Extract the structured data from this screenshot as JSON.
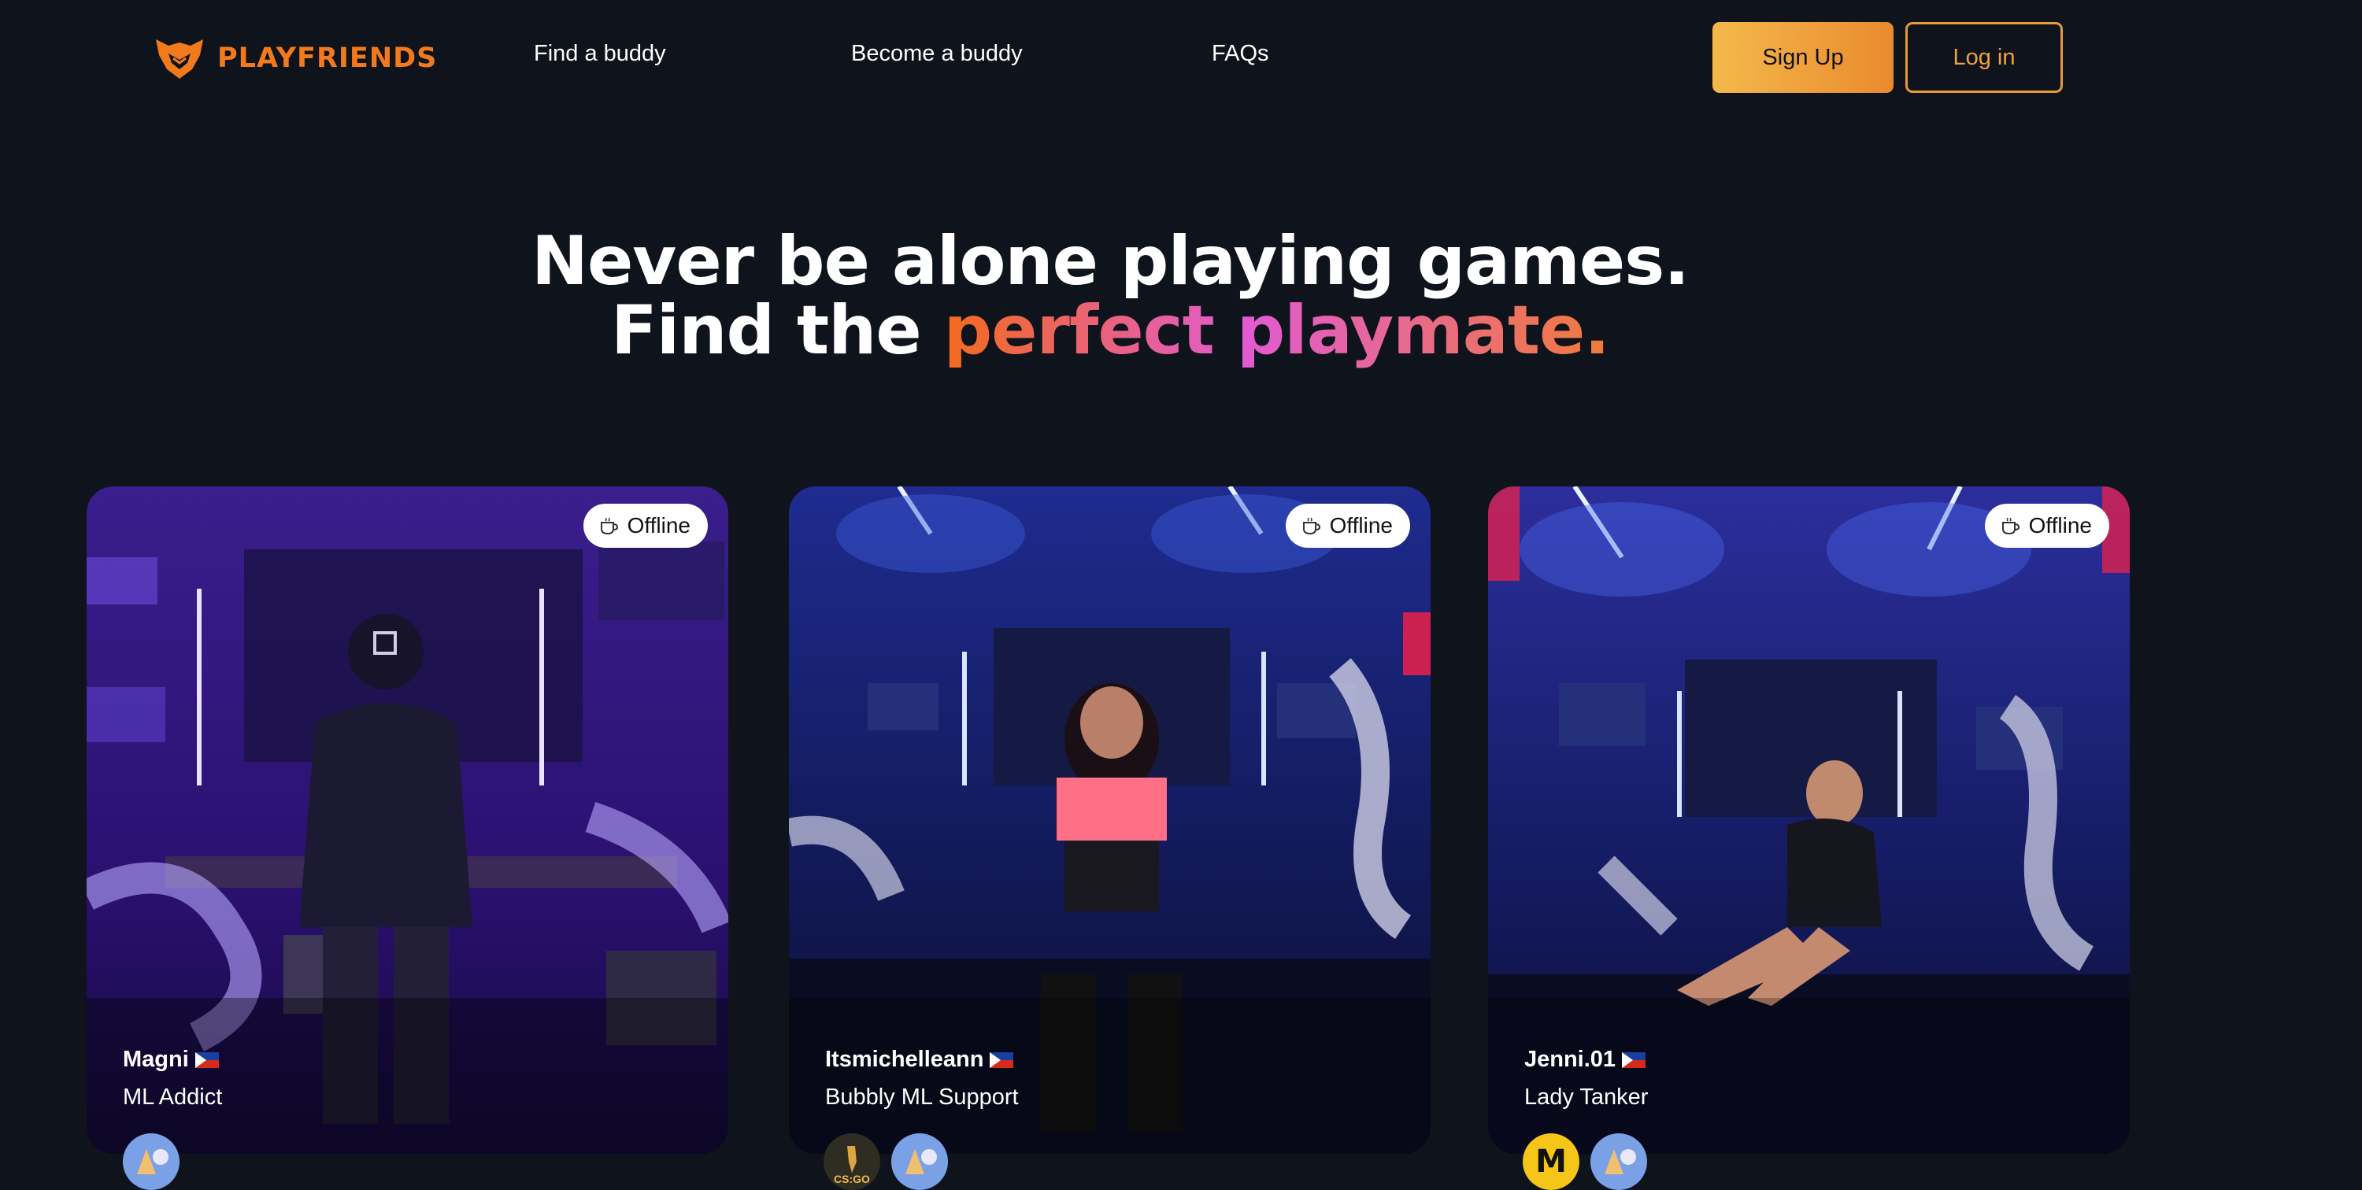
{
  "brand": {
    "name": "PLAYFRIENDS"
  },
  "nav": {
    "links": [
      "Find a buddy",
      "Become a buddy",
      "FAQs"
    ],
    "signup_label": "Sign Up",
    "login_label": "Log in"
  },
  "hero": {
    "line1": "Never be alone playing games.",
    "line2_prefix": "Find the",
    "line2_accent": "perfect playmate."
  },
  "cards": [
    {
      "name": "Magni",
      "tagline": "ML Addict",
      "status": "Offline",
      "flag": "philippines-flag",
      "games": [
        "mobile-legends"
      ]
    },
    {
      "name": "Itsmichelleann",
      "tagline": "Bubbly ML Support",
      "status": "Offline",
      "flag": "philippines-flag",
      "games": [
        "csgo",
        "mobile-legends"
      ]
    },
    {
      "name": "Jenni.01",
      "tagline": "Lady Tanker",
      "status": "Offline",
      "flag": "philippines-flag",
      "games": [
        "mlbb-badge",
        "mobile-legends"
      ]
    }
  ],
  "badge_text": {
    "csgo": "CS:GO",
    "mlbb": "M"
  },
  "colors": {
    "background": "#0f131c",
    "accent_orange": "#f27a1d",
    "accent_pink": "#e15bd2",
    "button_gold": "#f4b94b"
  }
}
